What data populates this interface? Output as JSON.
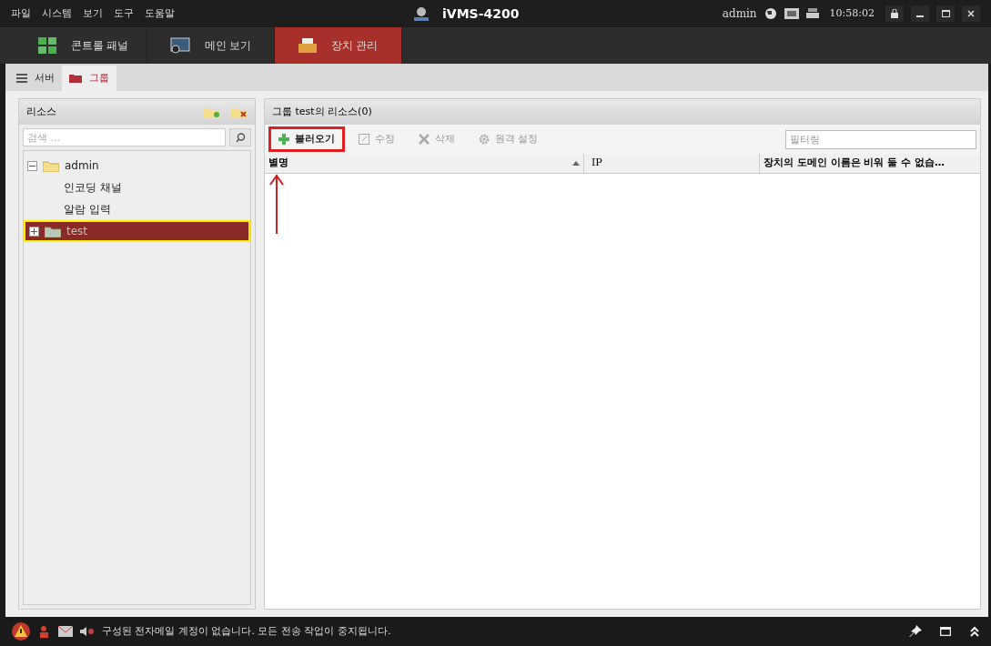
{
  "menu": [
    "파일",
    "시스템",
    "보기",
    "도구",
    "도움말"
  ],
  "window": {
    "title": "iVMS-4200",
    "user": "admin",
    "time": "10:58:02"
  },
  "nav_tabs": [
    {
      "label": "콘트롤 패널",
      "kind": "grid",
      "selected": false
    },
    {
      "label": "메인 보기",
      "kind": "monitor",
      "selected": false
    },
    {
      "label": "장치 관리",
      "kind": "device",
      "selected": true
    }
  ],
  "sub_tabs": [
    {
      "label": "서버",
      "kind": "list",
      "selected": false
    },
    {
      "label": "그룹",
      "kind": "folder",
      "selected": true
    }
  ],
  "resources": {
    "title": "리소스",
    "search": {
      "placeholder": "검색 ..."
    },
    "tree": [
      {
        "label": "admin",
        "kind": "folder",
        "expanded": true,
        "selected": false,
        "children": [
          {
            "label": "인코딩 채널",
            "kind": "leaf",
            "selected": false
          },
          {
            "label": "알람 입력",
            "kind": "leaf",
            "selected": false
          }
        ]
      },
      {
        "label": "test",
        "kind": "folder",
        "expanded": false,
        "selected": true
      }
    ]
  },
  "group": {
    "title": "그룹 test의 리소스(0)",
    "toolbar": [
      {
        "label": "불러오기",
        "kind": "add",
        "disabled": false,
        "highlighted": true
      },
      {
        "label": "수정",
        "kind": "edit",
        "disabled": true,
        "highlighted": false
      },
      {
        "label": "삭제",
        "kind": "delete",
        "disabled": true,
        "highlighted": false
      },
      {
        "label": "원격 설정",
        "kind": "gear",
        "disabled": true,
        "highlighted": false
      }
    ],
    "filter": {
      "placeholder": "필터링"
    },
    "columns": [
      {
        "label": "별명",
        "sorted": true
      },
      {
        "label": "IP",
        "sorted": false
      },
      {
        "label": "장치의 도메인 이름은 비워 둘 수 없습…",
        "sorted": false
      }
    ]
  },
  "status_bar": {
    "message": "구성된 전자메일 계정이 없습니다. 모든 전송 작업이 중지됩니다."
  }
}
